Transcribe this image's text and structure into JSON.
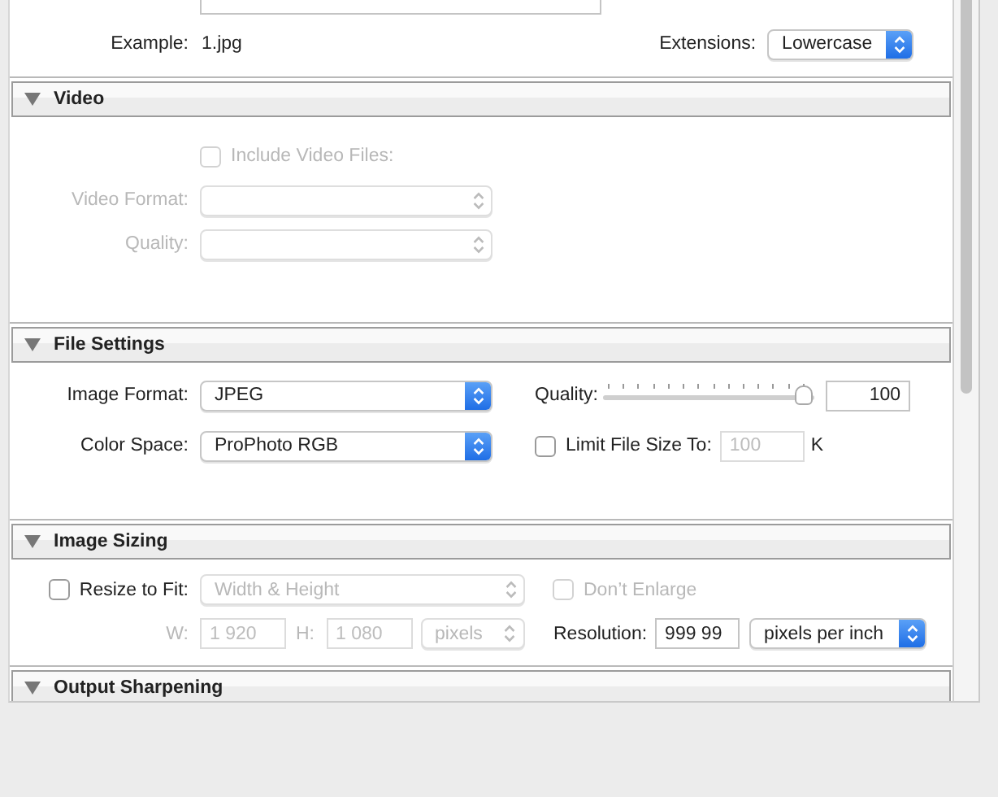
{
  "file_naming": {
    "example": {
      "label": "Example:",
      "value": "1.jpg"
    },
    "extensions": {
      "label": "Extensions:",
      "value": "Lowercase"
    }
  },
  "sections": [
    {
      "kind": "video",
      "title": "Video",
      "expanded": true,
      "include": {
        "label": "Include Video Files:",
        "checked": false,
        "disabled": true
      },
      "format": {
        "label": "Video Format:",
        "disabled": true
      },
      "quality": {
        "label": "Quality:",
        "disabled": true
      }
    },
    {
      "kind": "file_settings",
      "title": "File Settings",
      "expanded": true,
      "image_format": {
        "label": "Image Format:",
        "value": "JPEG"
      },
      "quality": {
        "label": "Quality:",
        "level": 1.0,
        "value": "100"
      },
      "color_space": {
        "label": "Color Space:",
        "value": "ProPhoto RGB"
      },
      "limit": {
        "label": "Limit File Size To:",
        "checked": false,
        "value": "100",
        "value_disabled": true,
        "unit": "K"
      }
    },
    {
      "kind": "image_sizing",
      "title": "Image Sizing",
      "expanded": true,
      "resize": {
        "label": "Resize to Fit:",
        "checked": false,
        "mode": "Width & Height",
        "mode_disabled": true
      },
      "dont_enlarge": {
        "label": "Don’t Enlarge",
        "checked": false,
        "disabled": true
      },
      "width": {
        "label": "W:",
        "value": "1 920",
        "disabled": true
      },
      "height": {
        "label": "H:",
        "value": "1 080",
        "disabled": true
      },
      "units": {
        "value": "pixels",
        "disabled": true
      },
      "resolution": {
        "label": "Resolution:",
        "value": "999 99",
        "unit": "pixels per inch"
      }
    },
    {
      "kind": "output_sharpening",
      "title": "Output Sharpening",
      "expanded": true
    }
  ]
}
